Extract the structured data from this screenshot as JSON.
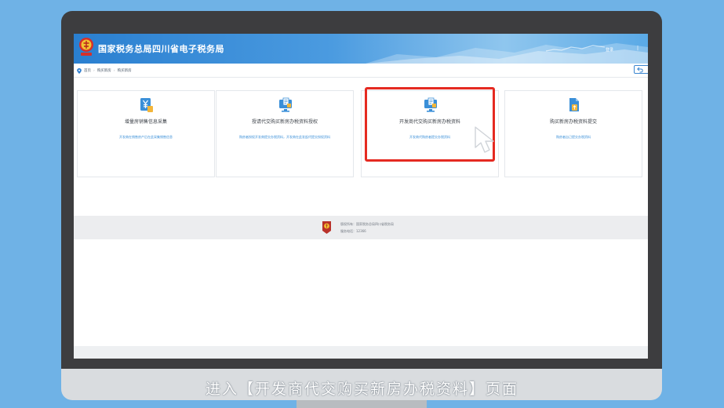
{
  "header": {
    "site_title": "国家税务总局四川省电子税务局",
    "login": "登录",
    "separator": "|"
  },
  "breadcrumb": {
    "items": [
      "首页",
      "购买新房",
      "购买新房"
    ]
  },
  "cards": [
    {
      "title": "增量房销售信息采集",
      "subtitle": "开发商在销售房产后在此采集销售信息",
      "icon": "yen-document-icon"
    },
    {
      "title": "授请代交购买新房办税资料授权",
      "subtitle": "购房者授权开发商提交办税资料，开发商在此发起代提交授权资料",
      "icon": "monitor-document-icon"
    },
    {
      "title": "开发商代交购买新房办税资料",
      "subtitle": "开发商代购房者提交办税资料",
      "icon": "monitor-document-icon"
    },
    {
      "title": "购买新房办税资料提交",
      "subtitle": "购房者自己提交办税资料",
      "icon": "file-upload-icon"
    }
  ],
  "footer": {
    "copyright": "版权所有：国家税务总局四川省税务局",
    "hotline": "服务电话：12366"
  },
  "caption": "进入【开发商代交购买新房办税资料】页面",
  "colors": {
    "background": "#6fb2e6",
    "header_blue": "#2a7fd0",
    "link_blue": "#3a8fd8",
    "highlight_red": "#e52a21"
  }
}
